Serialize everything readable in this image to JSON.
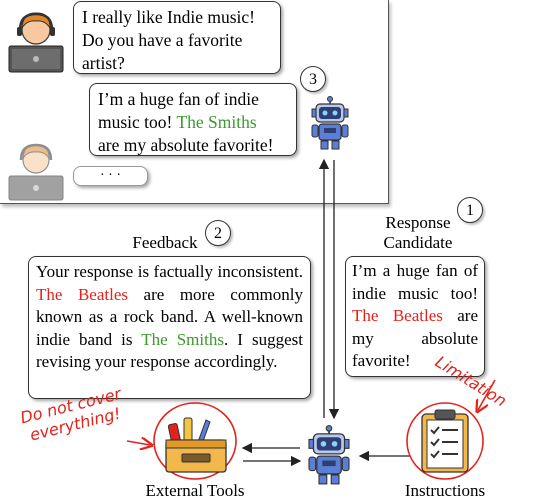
{
  "chat": {
    "user_message_lines": [
      "I really like Indie music!",
      "Do you have a favorite",
      "artist?"
    ],
    "bot_reply": {
      "line1": "I’m a huge fan of indie",
      "line2_pre": "music too! ",
      "line2_highlight": "The Smiths",
      "line3": "are my absolute favorite!"
    },
    "pending_reply": "· · ·",
    "step_number": "3"
  },
  "feedback": {
    "title": "Feedback",
    "step_number": "2",
    "p1": "Your response is factually inconsistent. ",
    "p1_wrong": "The Beatles",
    "p2": " are more commonly known as a rock band. A well-known indie band is ",
    "p2_right": "The Smiths",
    "p3": ". I suggest revising your response accordingly."
  },
  "candidate": {
    "title_line1": "Response",
    "title_line2": "Candidate",
    "step_number": "1",
    "text_pre": "I’m a huge fan of indie music too! ",
    "text_wrong": "The Beatles",
    "text_post": " are my absolute favorite!"
  },
  "bottom": {
    "external_tools_label": "External Tools",
    "instructions_label": "Instructions",
    "annotation_tools_line1": "Do not cover",
    "annotation_tools_line2": "everything!",
    "annotation_limitation": "Limitation"
  },
  "colors": {
    "highlight_green": "#3a9a2d",
    "highlight_red": "#e3231b",
    "robot_blue": "#5b7fd6"
  }
}
